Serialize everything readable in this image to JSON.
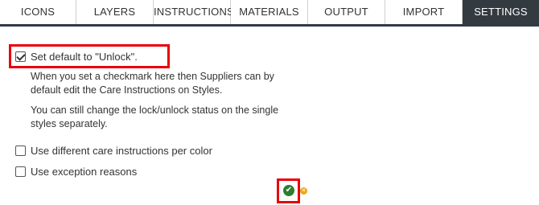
{
  "tabs": [
    {
      "label": "ICONS",
      "active": false
    },
    {
      "label": "LAYERS",
      "active": false
    },
    {
      "label": "INSTRUCTIONS",
      "active": false
    },
    {
      "label": "MATERIALS",
      "active": false
    },
    {
      "label": "OUTPUT",
      "active": false
    },
    {
      "label": "IMPORT",
      "active": false
    },
    {
      "label": "SETTINGS",
      "active": true
    }
  ],
  "settings": {
    "unlock": {
      "label": "Set default to \"Unlock\".",
      "checked": true,
      "description_1": "When you set a checkmark here then Suppliers can by default edit the Care Instructions on Styles.",
      "description_2": "You can still change the lock/unlock status on the single styles separately."
    },
    "care_per_color": {
      "label": "Use different care instructions per color",
      "checked": false
    },
    "exception_reasons": {
      "label": "Use exception reasons",
      "checked": false
    }
  },
  "actions": {
    "save_icon": "check-circle-icon",
    "cancel_icon": "close-circle-icon"
  },
  "colors": {
    "tab_active_bg": "#333a40",
    "highlight": "#e8000b",
    "save_green": "#2e7d32",
    "cancel_orange": "#e8a813"
  }
}
